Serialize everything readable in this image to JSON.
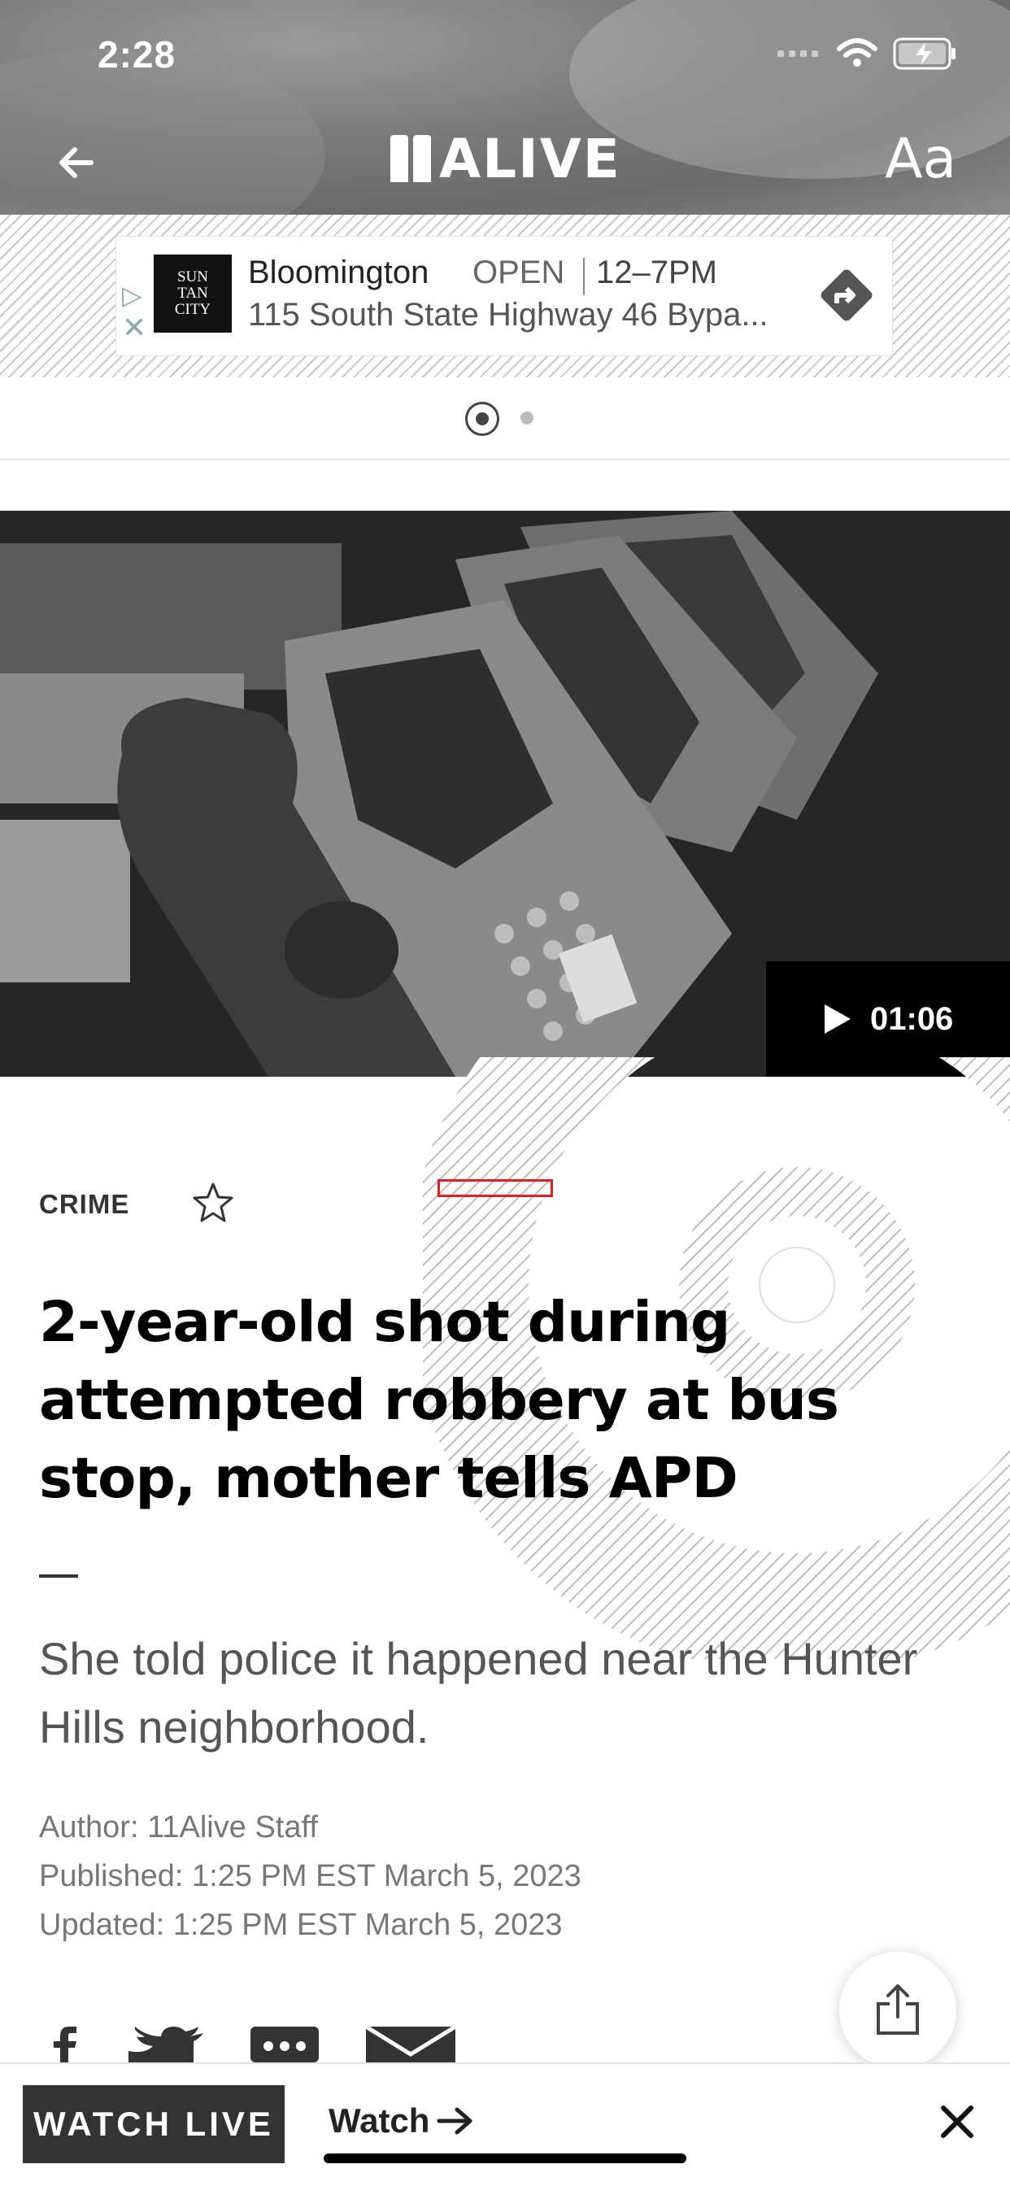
{
  "status_bar": {
    "time": "2:28"
  },
  "header": {
    "logo_text": "ALIVE",
    "font_size_label": "Aa"
  },
  "ad": {
    "brand_logo_text": [
      "SUN",
      "TAN",
      "CITY"
    ],
    "store_name": "Bloomington",
    "status": "OPEN",
    "hours": "12–7PM",
    "address": "115 South State Highway 46 Bypa..."
  },
  "video": {
    "duration": "01:06"
  },
  "article": {
    "category": "CRIME",
    "headline": "2-year-old shot during attempted robbery at bus stop, mother tells APD",
    "subheadline": "She told police it happened near the Hunter Hills neighborhood.",
    "author": "Author: 11Alive Staff",
    "published": "Published: 1:25 PM EST March 5, 2023",
    "updated": "Updated: 1:25 PM EST March 5, 2023"
  },
  "bottom_bar": {
    "watch_live_label": "WATCH LIVE",
    "watch_label": "Watch"
  },
  "colors": {
    "header_bg": "#7a7a7a",
    "highlight_outline": "#e02020",
    "watch_live_bg": "#333333"
  }
}
